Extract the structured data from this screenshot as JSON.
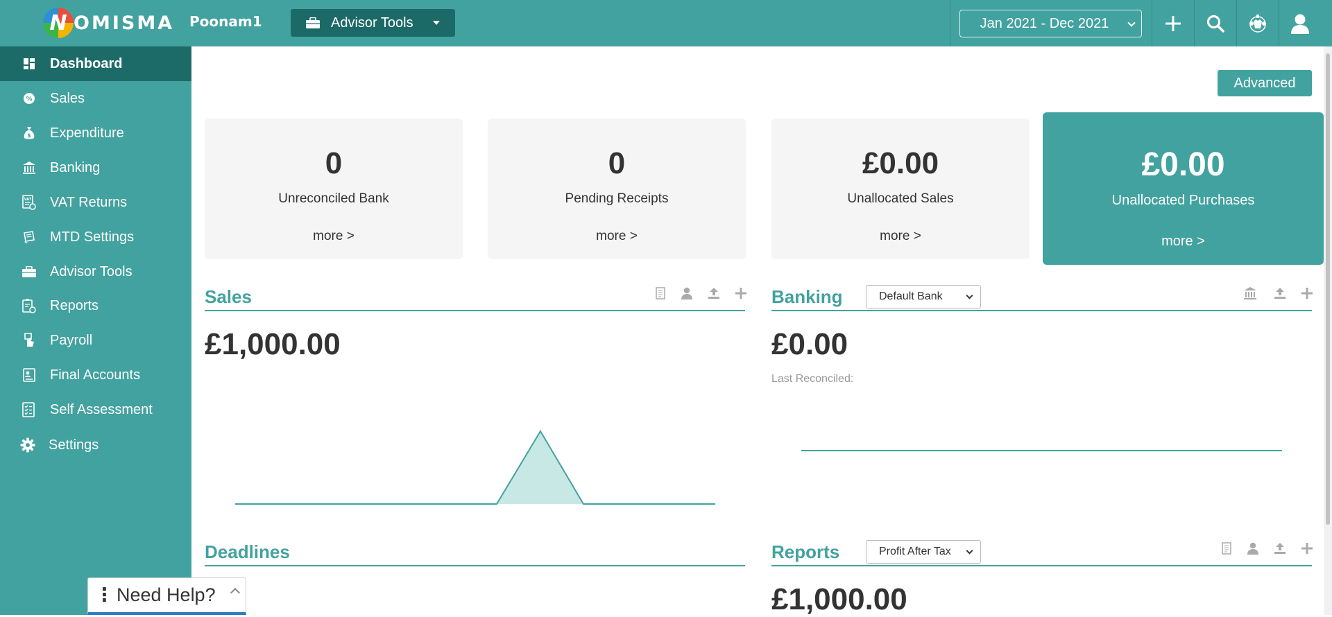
{
  "header": {
    "logo_letter": "N",
    "logo_text": "OMISMA",
    "company": "Poonam1",
    "advisor_tools_label": "Advisor Tools",
    "date_range": "Jan 2021 - Dec 2021"
  },
  "sidebar": {
    "items": [
      {
        "label": "Dashboard",
        "icon": "dashboard-icon"
      },
      {
        "label": "Sales",
        "icon": "sales-icon"
      },
      {
        "label": "Expenditure",
        "icon": "money-bag-icon"
      },
      {
        "label": "Banking",
        "icon": "bank-icon"
      },
      {
        "label": "VAT Returns",
        "icon": "vat-icon"
      },
      {
        "label": "MTD Settings",
        "icon": "mtd-icon"
      },
      {
        "label": "Advisor Tools",
        "icon": "briefcase-icon"
      },
      {
        "label": "Reports",
        "icon": "reports-icon"
      },
      {
        "label": "Payroll",
        "icon": "payroll-icon"
      },
      {
        "label": "Final Accounts",
        "icon": "final-accounts-icon"
      },
      {
        "label": "Self Assessment",
        "icon": "self-assessment-icon"
      },
      {
        "label": "Settings",
        "icon": "gear-icon"
      }
    ]
  },
  "help": {
    "label": "Need Help?"
  },
  "main": {
    "advanced_label": "Advanced",
    "cards": [
      {
        "value": "0",
        "label": "Unreconciled Bank",
        "more": "more >"
      },
      {
        "value": "0",
        "label": "Pending Receipts",
        "more": "more >"
      },
      {
        "value": "£0.00",
        "label": "Unallocated Sales",
        "more": "more >"
      },
      {
        "value": "£0.00",
        "label": "Unallocated Purchases",
        "more": "more >"
      }
    ],
    "sales": {
      "title": "Sales",
      "amount": "£1,000.00"
    },
    "banking": {
      "title": "Banking",
      "select": "Default Bank",
      "amount": "£0.00",
      "last_reconciled": "Last Reconciled:"
    },
    "deadlines": {
      "title": "Deadlines"
    },
    "reports": {
      "title": "Reports",
      "select": "Profit After Tax",
      "amount": "£1,000.00"
    }
  },
  "colors": {
    "accent": "#42a29f",
    "accent_dark": "#1d6b68",
    "chart_fill": "#c8e8e6"
  }
}
